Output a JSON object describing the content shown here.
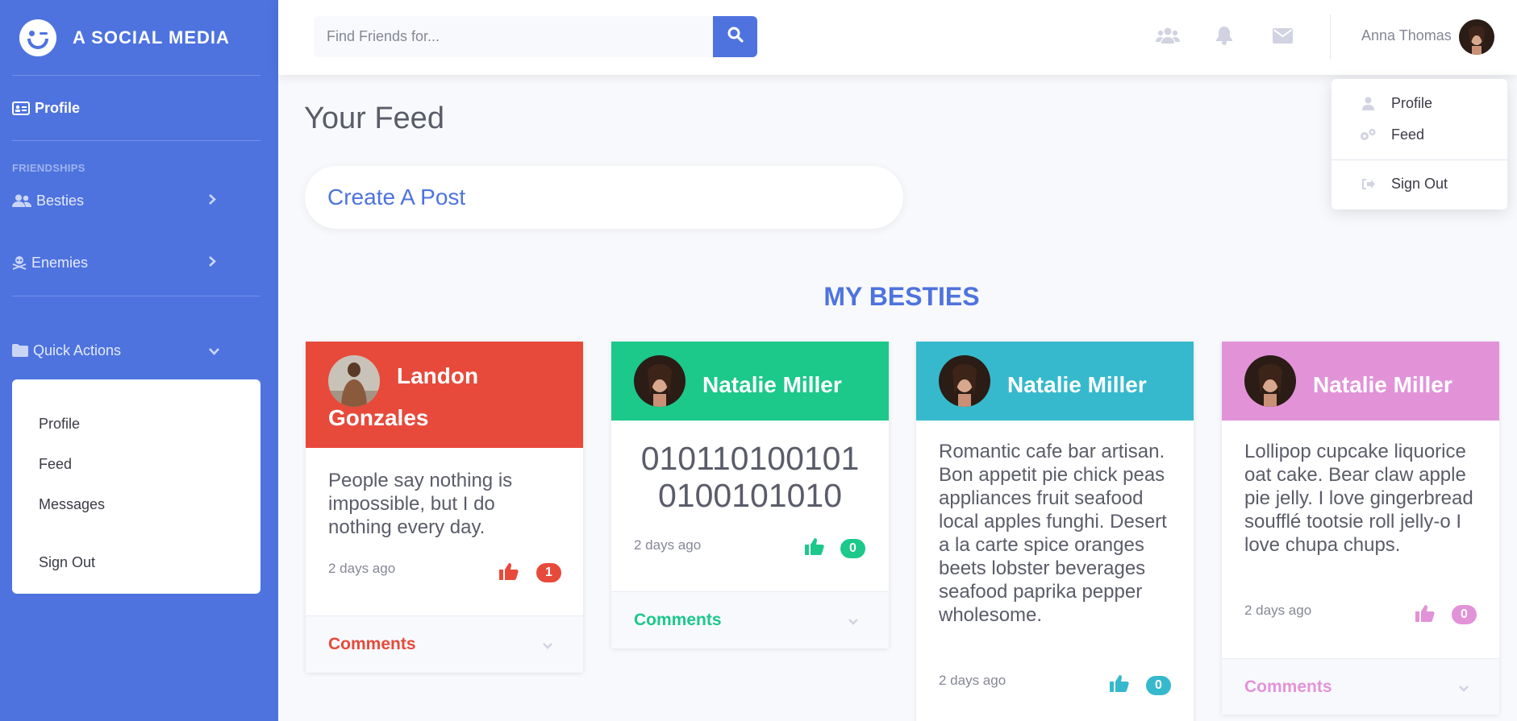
{
  "brand": {
    "name": "A SOCIAL MEDIA"
  },
  "sidebar": {
    "profile": "Profile",
    "section_heading": "FRIENDSHIPS",
    "besties": "Besties",
    "enemies": "Enemies",
    "quick_actions": "Quick Actions",
    "quick_items": [
      "Profile",
      "Feed",
      "Messages",
      "Sign Out"
    ]
  },
  "topbar": {
    "search_placeholder": "Find Friends for...",
    "user_name": "Anna Thomas"
  },
  "user_dropdown": {
    "items": [
      "Profile",
      "Feed",
      "Sign Out"
    ]
  },
  "main": {
    "title": "Your Feed",
    "create_post": "Create A Post",
    "besties_heading": "MY BESTIES"
  },
  "cards": [
    {
      "name_line1": "Landon",
      "name_line2": "Gonzales",
      "text": "People say nothing is impossible, but I do nothing every day.",
      "time": "2 days ago",
      "likes": "1",
      "comments": "Comments",
      "color": "#e74a3b"
    },
    {
      "name": "Natalie Miller",
      "binary1": "010110100101",
      "binary2": "0100101010",
      "time": "2 days ago",
      "likes": "0",
      "comments": "Comments",
      "color": "#1cc88a"
    },
    {
      "name": "Natalie Miller",
      "text": "Romantic cafe bar artisan. Bon appetit pie chick peas appliances fruit seafood local apples funghi. Desert a la carte spice oranges beets lobster beverages seafood paprika pepper wholesome.",
      "time": "2 days ago",
      "likes": "0",
      "comments": "Comments",
      "color": "#36b9cc"
    },
    {
      "name": "Natalie Miller",
      "text": "Lollipop cupcake liquorice oat cake. Bear claw apple pie jelly. I love gingerbread soufflé tootsie roll jelly-o I love chupa chups.",
      "time": "2 days ago",
      "likes": "0",
      "comments": "Comments",
      "color": "#e293d8"
    }
  ],
  "colors": {
    "primary": "#4e73df",
    "red": "#e74a3b",
    "green": "#1cc88a",
    "teal": "#36b9cc",
    "pink": "#e293d8"
  }
}
